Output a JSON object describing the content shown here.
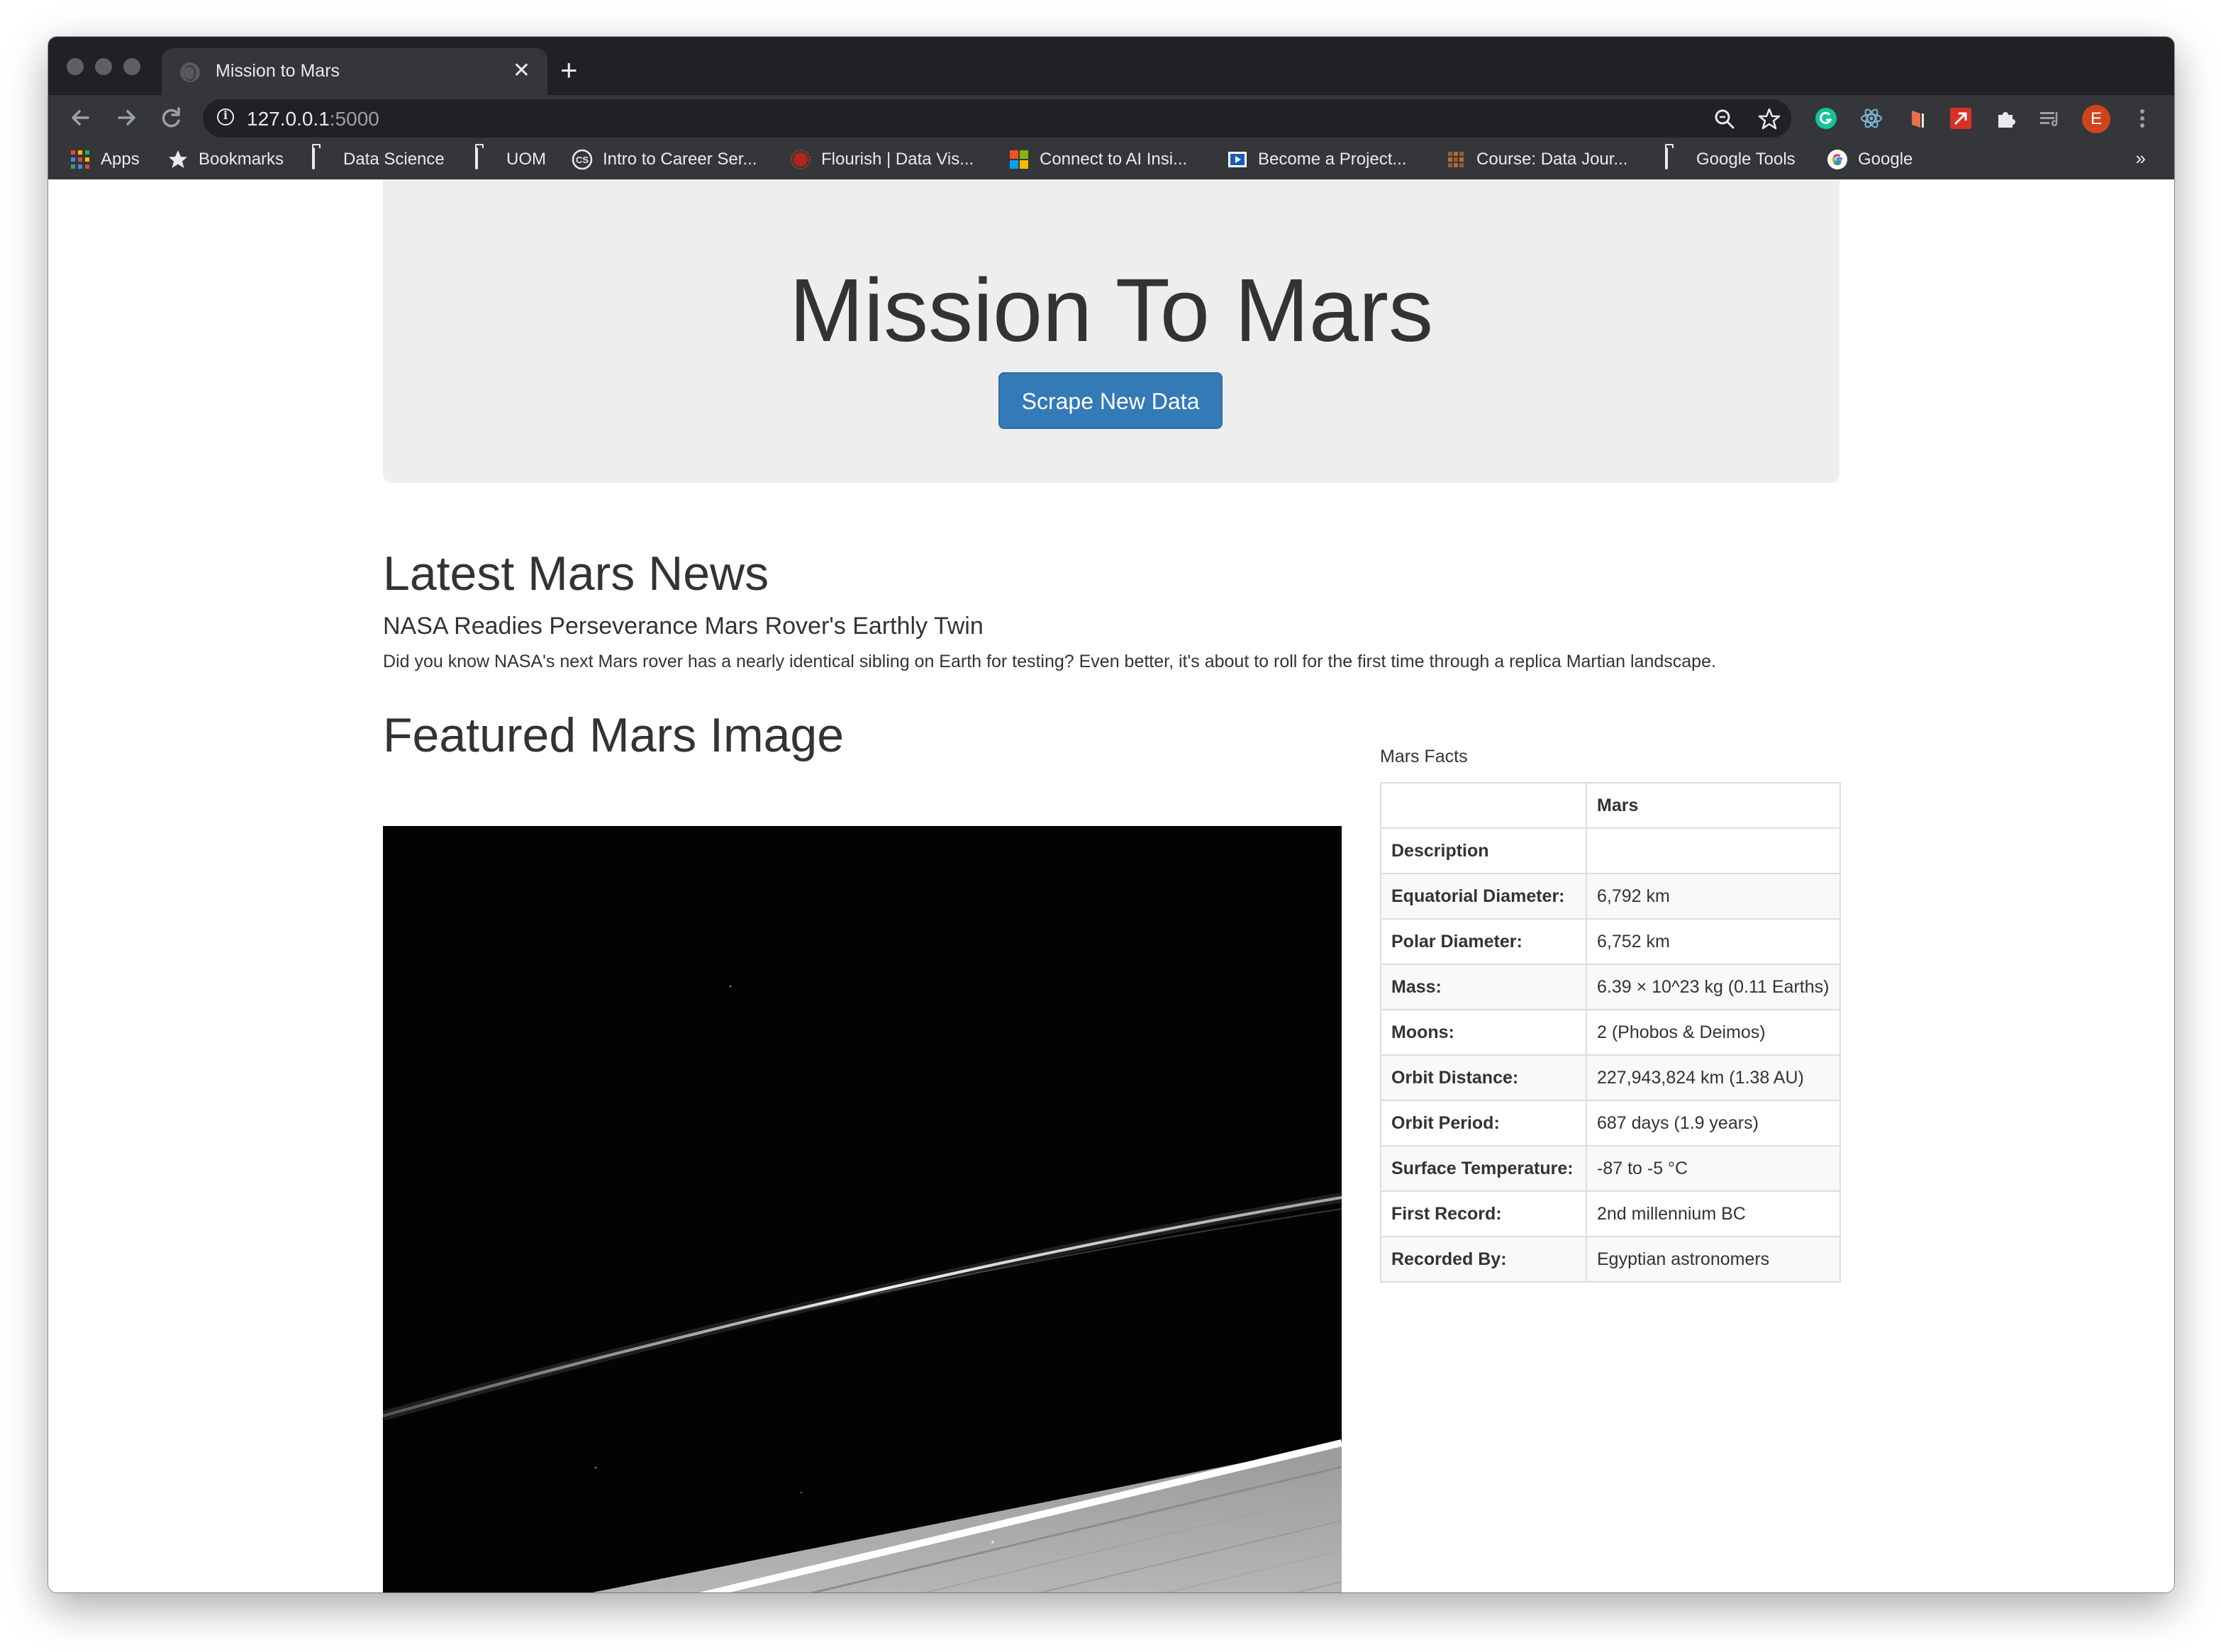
{
  "browser": {
    "tab": {
      "title": "Mission to Mars",
      "close_glyph": "✕"
    },
    "new_tab_glyph": "+",
    "address": {
      "host": "127.0.0.1",
      "port": ":5000"
    },
    "profile_initial": "E",
    "bookmarks": [
      {
        "label": "Apps",
        "icon": "apps-grid-icon"
      },
      {
        "label": "Bookmarks",
        "icon": "star-icon"
      },
      {
        "label": "Data Science",
        "icon": "folder-icon"
      },
      {
        "label": "UOM",
        "icon": "folder-icon"
      },
      {
        "label": "Intro to Career Ser...",
        "icon": "cs-logo-icon"
      },
      {
        "label": "Flourish | Data Vis...",
        "icon": "flourish-logo-icon"
      },
      {
        "label": "Connect to AI Insi...",
        "icon": "microsoft-logo-icon"
      },
      {
        "label": "Become a Project...",
        "icon": "video-logo-icon"
      },
      {
        "label": "Course: Data Jour...",
        "icon": "course-logo-icon"
      },
      {
        "label": "Google Tools",
        "icon": "folder-icon"
      },
      {
        "label": "Google",
        "icon": "google-logo-icon"
      }
    ],
    "overflow_glyph": "»"
  },
  "page": {
    "title": "Mission To Mars",
    "scrape_button": "Scrape New Data",
    "news": {
      "heading": "Latest Mars News",
      "title": "NASA Readies Perseverance Mars Rover's Earthly Twin",
      "teaser": "Did you know NASA's next Mars rover has a nearly identical sibling on Earth for testing? Even better, it's about to roll for the first time through a replica Martian landscape."
    },
    "featured_image": {
      "heading": "Featured Mars Image"
    },
    "facts": {
      "caption": "Mars Facts",
      "column_header": "Mars",
      "index_label": "Description",
      "rows": [
        {
          "key": "Equatorial Diameter:",
          "value": "6,792 km"
        },
        {
          "key": "Polar Diameter:",
          "value": "6,752 km"
        },
        {
          "key": "Mass:",
          "value": "6.39 × 10^23 kg (0.11 Earths)"
        },
        {
          "key": "Moons:",
          "value": "2 (Phobos & Deimos)"
        },
        {
          "key": "Orbit Distance:",
          "value": "227,943,824 km (1.38 AU)"
        },
        {
          "key": "Orbit Period:",
          "value": "687 days (1.9 years)"
        },
        {
          "key": "Surface Temperature:",
          "value": "-87 to -5 °C"
        },
        {
          "key": "First Record:",
          "value": "2nd millennium BC"
        },
        {
          "key": "Recorded By:",
          "value": "Egyptian astronomers"
        }
      ]
    }
  },
  "colors": {
    "primary_button": "#337ab7",
    "jumbotron_bg": "#eeeeee",
    "browser_chrome": "#35363a"
  }
}
